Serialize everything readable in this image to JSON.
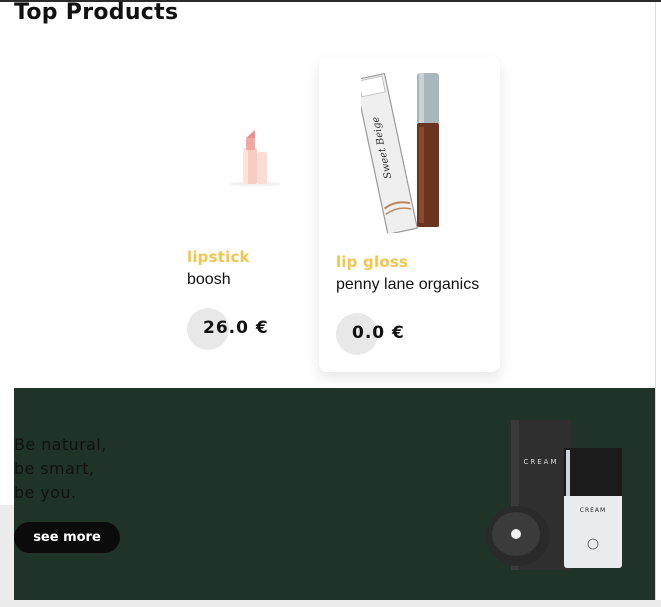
{
  "section": {
    "title": "Top Products"
  },
  "products": [
    {
      "category": "lipstick",
      "brand": "boosh",
      "price": "26.0 €"
    },
    {
      "category": "lip gloss",
      "brand": "penny lane organics",
      "price": "0.0 €"
    }
  ],
  "banner": {
    "slogan": [
      "Be natural,",
      "be smart,",
      "be you."
    ],
    "button_label": "see more",
    "box_label": "CREAM",
    "jar_label": "CREAM"
  },
  "product_images": {
    "lip_gloss_box_text": "Sweet Beige"
  },
  "colors": {
    "category": "#f3c54d",
    "banner_bg": "#1f3329",
    "button_bg": "#0b0b0b",
    "price_bubble": "#e8e8e8"
  }
}
